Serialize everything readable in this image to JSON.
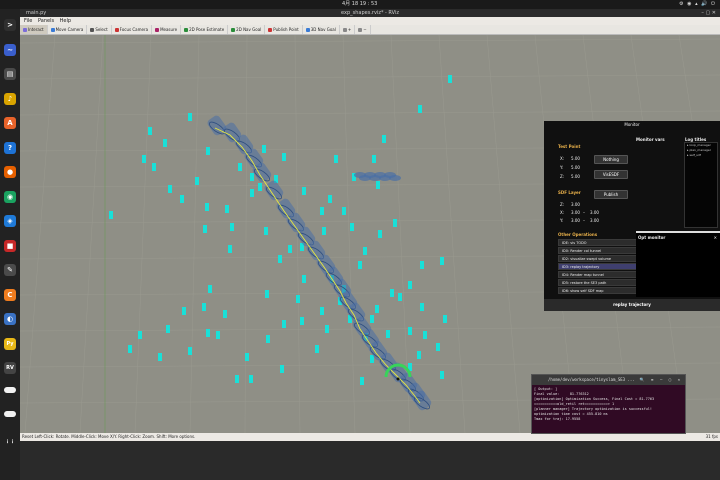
{
  "system": {
    "clock": "4月 18  19 : 53",
    "tray": "⚙ ◉ ▴ 🔊 ⏻"
  },
  "dock": {
    "items": [
      {
        "name": "terminal",
        "color": "#2f2f2f",
        "glyph": ">"
      },
      {
        "name": "monitor",
        "color": "#3a5fcd",
        "glyph": "~"
      },
      {
        "name": "files",
        "color": "#4a4a4a",
        "glyph": "▤"
      },
      {
        "name": "rhythmbox",
        "color": "#d9a400",
        "glyph": "♪"
      },
      {
        "name": "software",
        "color": "#e8632a",
        "glyph": "A"
      },
      {
        "name": "help",
        "color": "#1e73d6",
        "glyph": "?"
      },
      {
        "name": "firefox",
        "color": "#e66000",
        "glyph": "●"
      },
      {
        "name": "chrome",
        "color": "#1aa260",
        "glyph": "◉"
      },
      {
        "name": "vscode",
        "color": "#1f7ad8",
        "glyph": "◈"
      },
      {
        "name": "recorder",
        "color": "#c62828",
        "glyph": "■"
      },
      {
        "name": "gedit",
        "color": "#4b4b4b",
        "glyph": "✎"
      },
      {
        "name": "orange-app",
        "color": "#ef7c1e",
        "glyph": "C"
      },
      {
        "name": "system",
        "color": "#3a72c4",
        "glyph": "◐"
      },
      {
        "name": "python",
        "color": "#e8b817",
        "glyph": "Py"
      },
      {
        "name": "rviz",
        "color": "#444",
        "glyph": "RV"
      },
      {
        "name": "blank1",
        "color": "#f2f2f2",
        "glyph": ""
      },
      {
        "name": "blank2",
        "color": "#f2f2f2",
        "glyph": ""
      },
      {
        "name": "apps",
        "color": "#222",
        "glyph": "⋮⋮"
      }
    ]
  },
  "window": {
    "tab_title": "main.py",
    "title": "exp_shapes.rviz* - RViz"
  },
  "menubar": {
    "file": "File",
    "panels": "Panels",
    "help": "Help"
  },
  "toolbar": {
    "tools": [
      {
        "label": "Interact",
        "color": "#7b6cd9",
        "active": true
      },
      {
        "label": "Move Camera",
        "color": "#3a7bd5"
      },
      {
        "label": "Select",
        "color": "#555"
      },
      {
        "label": "Focus Camera",
        "color": "#cc3333"
      },
      {
        "label": "Measure",
        "color": "#a26"
      },
      {
        "label": "2D Pose Estimate",
        "color": "#2a8d3a"
      },
      {
        "label": "2D Nav Goal",
        "color": "#2a8d3a"
      },
      {
        "label": "Publish Point",
        "color": "#cc3333"
      },
      {
        "label": "3D Nav Goal",
        "color": "#3a7bd5"
      },
      {
        "label": "+",
        "color": "#888"
      },
      {
        "label": "−",
        "color": "#888"
      }
    ]
  },
  "statusbar": {
    "reset": "Reset",
    "hint": "Left-Click: Rotate. Middle-Click: Move X/Y. Right-Click: Zoom. Shift: More options.",
    "fps": "31 fps"
  },
  "monitor": {
    "title": "Monitor",
    "test_point_title": "Test Point",
    "x_label": "X:",
    "x_val": "5.00",
    "y_label": "Y:",
    "y_val": "5.00",
    "z_label": "Z:",
    "z_val": "5.00",
    "nothing_btn": "Nothing",
    "visesdf_btn": "VisESDF",
    "sdf_layer_title": "SDF Layer",
    "publish_btn": "Publish",
    "sdf_z_label": "Z:",
    "sdf_z_val": "3.00",
    "sdf_x_label": "X:",
    "sdf_x_from": "3.00",
    "sdf_x_to": "3.00",
    "sdf_y_label": "Y:",
    "sdf_y_from": "3.00",
    "sdf_y_to": "3.00",
    "other_ops_title": "Other Operations",
    "ops": [
      "IDE: vis TODO",
      "ID0: Render col tunnel",
      "ID2: visualize swept volume",
      "ID3: replay trajectory",
      "ID4: Render map tunnel",
      "ID5: restore the SE3 path",
      "ID6: show self SDF map"
    ],
    "selected_op": 3,
    "monitor_vars_title": "Monitor vars",
    "log_title": "Log titles",
    "log_items": [
      "▸ loop_manager",
      "▸ plan_manager",
      "▸ self_sdf"
    ],
    "opt_monitor_title": "Opt monitor",
    "footer": "replay trajectory"
  },
  "terminal": {
    "title": "/home/dev/workspace/tinyslam_SE3 ...",
    "lines": [
      "[ Output: ]",
      "Final value:     81.776312",
      "[optimization] Optimization Success, Final Cost = 81.7763",
      "===========old_retil ret===========> 1",
      "[planner manager] Trajectory optimization is successful!",
      "optimization time cost = 455.810 ms",
      "Tmax for traj: 17.9558"
    ]
  },
  "colors": {
    "viewport_bg": "#8f8f86",
    "obstacle": "#19e0d8",
    "robot": "#4a6fa5",
    "trajectory": "#e6e840",
    "goal_marker": "#39d35a"
  }
}
